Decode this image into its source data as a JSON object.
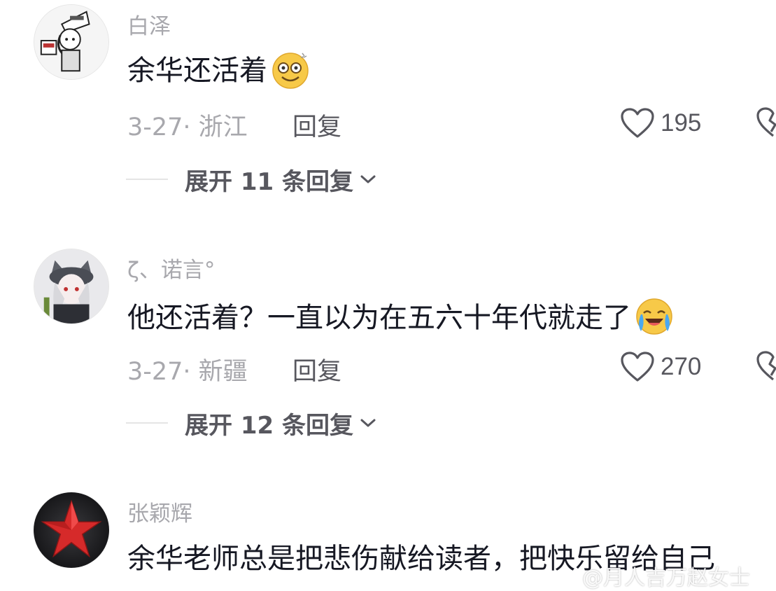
{
  "comments": [
    {
      "username": "白泽",
      "text": "余华还活着",
      "emoji": "dizzy-smile-emoji",
      "meta": "3-27· 浙江",
      "reply_label": "回复",
      "likes": "195",
      "expand_label": "展开 11 条回复"
    },
    {
      "username": "ζ、诺言°",
      "text": "他还活着？一直以为在五六十年代就走了",
      "emoji": "crying-laughing-emoji",
      "meta": "3-27· 新疆",
      "reply_label": "回复",
      "likes": "270",
      "expand_label": "展开 12 条回复"
    },
    {
      "username": "张颖辉",
      "text": "余华老师总是把悲伤献给读者，把快乐留给自己"
    }
  ],
  "watermark": "@月人吉万赵女士",
  "colors": {
    "username": "#a8a8ad",
    "text": "#161823",
    "secondary": "#57575e",
    "star_red": "#d62a2a"
  }
}
